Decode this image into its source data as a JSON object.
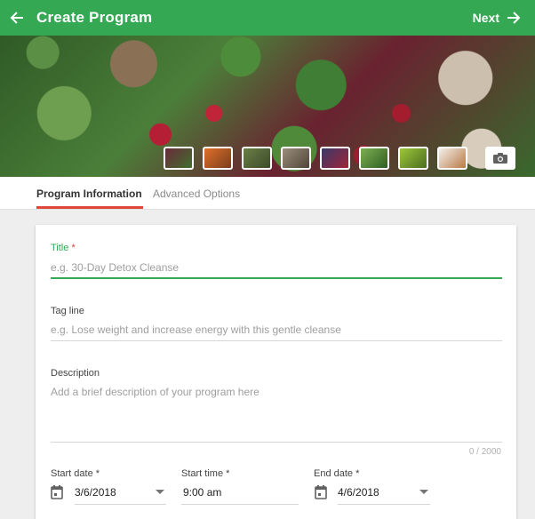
{
  "appbar": {
    "title": "Create Program",
    "next_label": "Next"
  },
  "hero": {
    "thumbnails": [
      "grape-salad",
      "carrots",
      "greens",
      "scissors-chopping",
      "berries",
      "leafy-greens",
      "tape-measure",
      "dancer"
    ],
    "camera_icon": "camera-icon"
  },
  "tabs": [
    {
      "label": "Program Information",
      "active": true
    },
    {
      "label": "Advanced Options",
      "active": false
    }
  ],
  "form": {
    "title": {
      "label": "Title",
      "required_mark": "*",
      "placeholder": "e.g. 30-Day Detox Cleanse"
    },
    "tagline": {
      "label": "Tag line",
      "placeholder": "e.g. Lose weight and increase energy with this gentle cleanse"
    },
    "description": {
      "label": "Description",
      "placeholder": "Add a brief description of your program here",
      "counter": "0 / 2000"
    },
    "start_date": {
      "label": "Start date",
      "required_mark": "*",
      "value": "3/6/2018"
    },
    "start_time": {
      "label": "Start time",
      "required_mark": "*",
      "value": "9:00 am"
    },
    "end_date": {
      "label": "End date",
      "required_mark": "*",
      "value": "4/6/2018"
    }
  },
  "colors": {
    "primary": "#34a853",
    "tab_indicator": "#e0473b",
    "required": "#e53935"
  }
}
